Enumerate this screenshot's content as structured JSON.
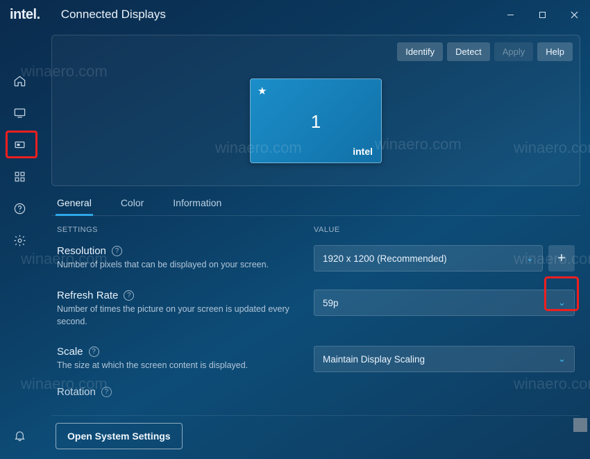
{
  "brand": "intel",
  "page_title": "Connected Displays",
  "top_actions": {
    "identify": "Identify",
    "detect": "Detect",
    "apply": "Apply",
    "help": "Help"
  },
  "display_tile": {
    "number": "1",
    "brand": "intel"
  },
  "tabs": {
    "general": "General",
    "color": "Color",
    "information": "Information"
  },
  "columns": {
    "settings": "SETTINGS",
    "value": "VALUE"
  },
  "settings": {
    "resolution": {
      "title": "Resolution",
      "desc": "Number of pixels that can be displayed on your screen.",
      "value": "1920 x 1200 (Recommended)"
    },
    "refresh_rate": {
      "title": "Refresh Rate",
      "desc": "Number of times the picture on your screen is updated every second.",
      "value": "59p"
    },
    "scale": {
      "title": "Scale",
      "desc": "The size at which the screen content is displayed.",
      "value": "Maintain Display Scaling"
    },
    "rotation": {
      "title": "Rotation"
    }
  },
  "open_system_settings": "Open System Settings",
  "watermark": "winaero.com"
}
